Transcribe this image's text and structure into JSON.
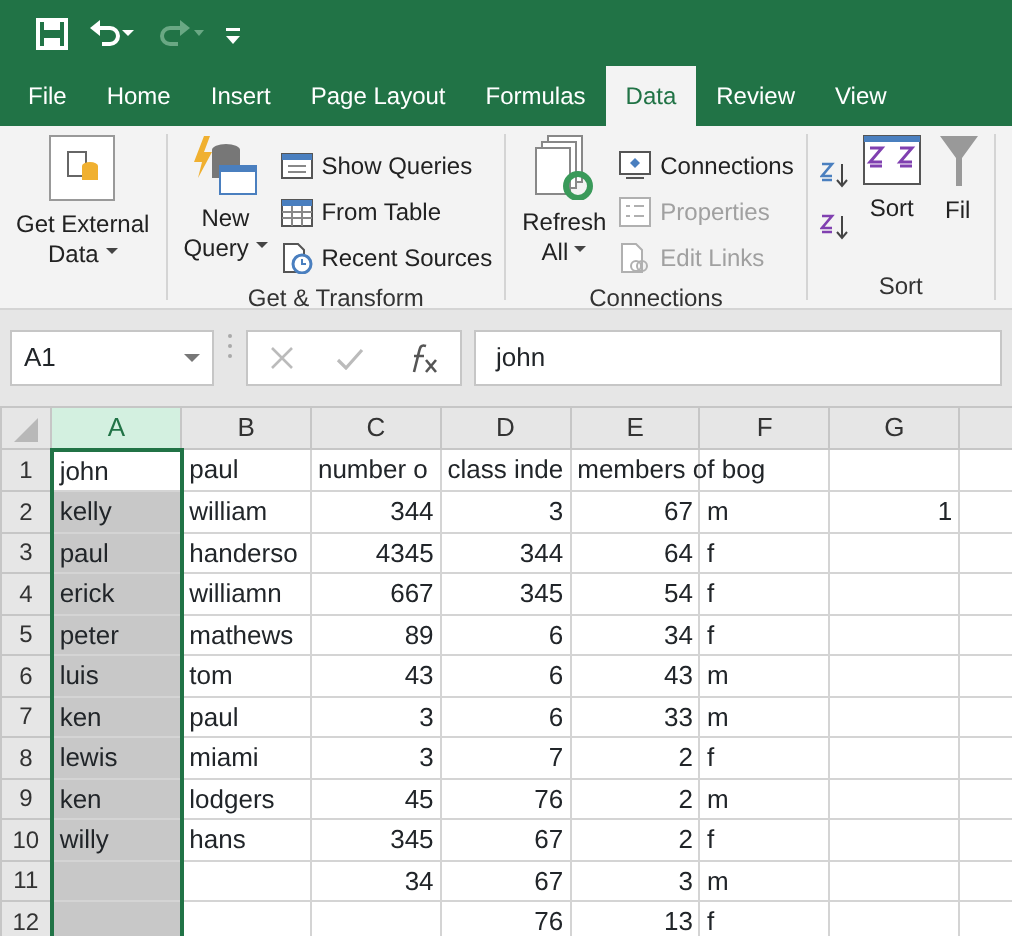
{
  "quick_access": [
    {
      "kind": "save",
      "disabled": false
    },
    {
      "kind": "undo",
      "disabled": false
    },
    {
      "kind": "redo",
      "disabled": true
    },
    {
      "kind": "customize",
      "disabled": false
    }
  ],
  "tabs": [
    {
      "label": "File",
      "selected": false
    },
    {
      "label": "Home",
      "selected": false
    },
    {
      "label": "Insert",
      "selected": false
    },
    {
      "label": "Page Layout",
      "selected": false
    },
    {
      "label": "Formulas",
      "selected": false
    },
    {
      "label": "Data",
      "selected": true
    },
    {
      "label": "Review",
      "selected": false
    },
    {
      "label": "View",
      "selected": false
    }
  ],
  "ribbon_groups": [
    {
      "items": [
        {
          "kind": "large",
          "label": "Get External Data",
          "dropdown": true,
          "disabled": false
        }
      ]
    },
    {
      "label": "Get & Transform",
      "items": [
        {
          "kind": "large",
          "label": "New Query",
          "dropdown": true,
          "disabled": false
        },
        {
          "kind": "stack",
          "children": [
            {
              "label": "Show Queries",
              "disabled": false
            },
            {
              "label": "From Table",
              "disabled": false
            },
            {
              "label": "Recent Sources",
              "disabled": false
            }
          ]
        }
      ]
    },
    {
      "label": "Connections",
      "items": [
        {
          "kind": "large",
          "label": "Refresh All",
          "dropdown": true,
          "disabled": false
        },
        {
          "kind": "stack",
          "children": [
            {
              "label": "Connections",
              "disabled": false
            },
            {
              "label": "Properties",
              "disabled": true
            },
            {
              "label": "Edit Links",
              "disabled": true
            }
          ]
        }
      ]
    },
    {
      "label": "Sort",
      "items": [
        {
          "kind": "sortpair"
        },
        {
          "kind": "large",
          "label": "Sort",
          "disabled": false
        },
        {
          "kind": "large",
          "label": "Fil",
          "disabled": false
        }
      ]
    }
  ],
  "name_box": "A1",
  "formula_bar": {
    "value": "john"
  },
  "columns": [
    {
      "label": "A",
      "selected": true
    },
    {
      "label": "B",
      "selected": false
    },
    {
      "label": "C",
      "selected": false
    },
    {
      "label": "D",
      "selected": false
    },
    {
      "label": "E",
      "selected": false
    },
    {
      "label": "F",
      "selected": false
    },
    {
      "label": "G",
      "selected": false
    },
    {
      "selected": false
    }
  ],
  "rows": [
    {
      "label": "1",
      "cells": [
        {
          "text": "john",
          "kind": "text"
        },
        {
          "text": "paul",
          "kind": "text"
        },
        {
          "text": "number o",
          "kind": "text"
        },
        {
          "text": "class inde",
          "kind": "text"
        },
        {
          "text": "members of bog",
          "kind": "text"
        },
        {
          "text": "",
          "kind": "text"
        },
        {
          "text": "",
          "kind": "text"
        },
        {
          "text": "",
          "kind": "text"
        }
      ]
    },
    {
      "label": "2",
      "cells": [
        {
          "text": "kelly",
          "kind": "text"
        },
        {
          "text": "william",
          "kind": "text"
        },
        {
          "text": "344",
          "kind": "number"
        },
        {
          "text": "3",
          "kind": "number"
        },
        {
          "text": "67",
          "kind": "number"
        },
        {
          "text": "m",
          "kind": "text"
        },
        {
          "text": "1",
          "kind": "number"
        },
        {
          "text": "",
          "kind": "text"
        }
      ]
    },
    {
      "label": "3",
      "cells": [
        {
          "text": "paul",
          "kind": "text"
        },
        {
          "text": "handerso",
          "kind": "text"
        },
        {
          "text": "4345",
          "kind": "number"
        },
        {
          "text": "344",
          "kind": "number"
        },
        {
          "text": "64",
          "kind": "number"
        },
        {
          "text": "f",
          "kind": "text"
        },
        {
          "text": "",
          "kind": "text"
        },
        {
          "text": "",
          "kind": "text"
        }
      ]
    },
    {
      "label": "4",
      "cells": [
        {
          "text": "erick",
          "kind": "text"
        },
        {
          "text": "williamn",
          "kind": "text"
        },
        {
          "text": "667",
          "kind": "number"
        },
        {
          "text": "345",
          "kind": "number"
        },
        {
          "text": "54",
          "kind": "number"
        },
        {
          "text": "f",
          "kind": "text"
        },
        {
          "text": "",
          "kind": "text"
        },
        {
          "text": "",
          "kind": "text"
        }
      ]
    },
    {
      "label": "5",
      "cells": [
        {
          "text": "peter",
          "kind": "text"
        },
        {
          "text": "mathews",
          "kind": "text"
        },
        {
          "text": "89",
          "kind": "number"
        },
        {
          "text": "6",
          "kind": "number"
        },
        {
          "text": "34",
          "kind": "number"
        },
        {
          "text": "f",
          "kind": "text"
        },
        {
          "text": "",
          "kind": "text"
        },
        {
          "text": "",
          "kind": "text"
        }
      ]
    },
    {
      "label": "6",
      "cells": [
        {
          "text": "luis",
          "kind": "text"
        },
        {
          "text": "tom",
          "kind": "text"
        },
        {
          "text": "43",
          "kind": "number"
        },
        {
          "text": "6",
          "kind": "number"
        },
        {
          "text": "43",
          "kind": "number"
        },
        {
          "text": "m",
          "kind": "text"
        },
        {
          "text": "",
          "kind": "text"
        },
        {
          "text": "",
          "kind": "text"
        }
      ]
    },
    {
      "label": "7",
      "cells": [
        {
          "text": "ken",
          "kind": "text"
        },
        {
          "text": "paul",
          "kind": "text"
        },
        {
          "text": "3",
          "kind": "number"
        },
        {
          "text": "6",
          "kind": "number"
        },
        {
          "text": "33",
          "kind": "number"
        },
        {
          "text": "m",
          "kind": "text"
        },
        {
          "text": "",
          "kind": "text"
        },
        {
          "text": "",
          "kind": "text"
        }
      ]
    },
    {
      "label": "8",
      "cells": [
        {
          "text": "lewis",
          "kind": "text"
        },
        {
          "text": "miami",
          "kind": "text"
        },
        {
          "text": "3",
          "kind": "number"
        },
        {
          "text": "7",
          "kind": "number"
        },
        {
          "text": "2",
          "kind": "number"
        },
        {
          "text": "f",
          "kind": "text"
        },
        {
          "text": "",
          "kind": "text"
        },
        {
          "text": "",
          "kind": "text"
        }
      ]
    },
    {
      "label": "9",
      "cells": [
        {
          "text": "ken",
          "kind": "text"
        },
        {
          "text": "lodgers",
          "kind": "text"
        },
        {
          "text": "45",
          "kind": "number"
        },
        {
          "text": "76",
          "kind": "number"
        },
        {
          "text": "2",
          "kind": "number"
        },
        {
          "text": "m",
          "kind": "text"
        },
        {
          "text": "",
          "kind": "text"
        },
        {
          "text": "",
          "kind": "text"
        }
      ]
    },
    {
      "label": "10",
      "cells": [
        {
          "text": "willy",
          "kind": "text"
        },
        {
          "text": "hans",
          "kind": "text"
        },
        {
          "text": "345",
          "kind": "number"
        },
        {
          "text": "67",
          "kind": "number"
        },
        {
          "text": "2",
          "kind": "number"
        },
        {
          "text": "f",
          "kind": "text"
        },
        {
          "text": "",
          "kind": "text"
        },
        {
          "text": "",
          "kind": "text"
        }
      ]
    },
    {
      "label": "11",
      "cells": [
        {
          "text": "",
          "kind": "text"
        },
        {
          "text": "",
          "kind": "text"
        },
        {
          "text": "34",
          "kind": "number"
        },
        {
          "text": "67",
          "kind": "number"
        },
        {
          "text": "3",
          "kind": "number"
        },
        {
          "text": "m",
          "kind": "text"
        },
        {
          "text": "",
          "kind": "text"
        },
        {
          "text": "",
          "kind": "text"
        }
      ]
    },
    {
      "label": "12",
      "cells": [
        {
          "text": "",
          "kind": "text"
        },
        {
          "text": "",
          "kind": "text"
        },
        {
          "text": "",
          "kind": "number"
        },
        {
          "text": "76",
          "kind": "number"
        },
        {
          "text": "13",
          "kind": "number"
        },
        {
          "text": "f",
          "kind": "text"
        },
        {
          "text": "",
          "kind": "text"
        },
        {
          "text": "",
          "kind": "text"
        }
      ]
    }
  ]
}
